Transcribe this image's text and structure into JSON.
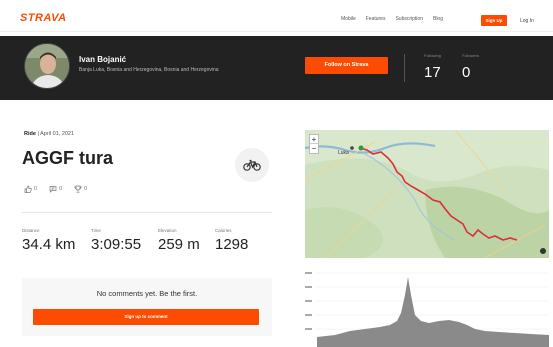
{
  "nav": {
    "logo": "STRAVA",
    "links": [
      "Mobile",
      "Features",
      "Subscription",
      "Blog"
    ],
    "signup_label": "Sign Up",
    "login_label": "Log In"
  },
  "athlete": {
    "name": "Ivan Bojanić",
    "location": "Banja Luka, Bosnia and Herzegovina, Bosnia and Herzegovina",
    "follow_label": "Follow on Strava",
    "stats": [
      {
        "label": "Following",
        "value": "17"
      },
      {
        "label": "Followers",
        "value": "0"
      }
    ]
  },
  "activity": {
    "type": "Ride",
    "date": "April 01, 2021",
    "title": "AGGF tura",
    "sport_icon": "bike-icon",
    "kudos_count": "0",
    "comments_count": "0",
    "trophies_count": "0",
    "stats": [
      {
        "label": "Distance",
        "value": "34.4 km"
      },
      {
        "label": "Time",
        "value": "3:09:55"
      },
      {
        "label": "Elevation",
        "value": "259 m"
      },
      {
        "label": "Calories",
        "value": "1298"
      }
    ]
  },
  "comments": {
    "empty_text": "No comments yet. Be the first.",
    "signin_label": "Sign up to comment"
  },
  "map": {
    "zoom_in": "+",
    "zoom_out": "−",
    "place_start": "Luka"
  },
  "colors": {
    "brand": "#fc4c02",
    "banner": "#222222",
    "route": "#d9303a"
  }
}
